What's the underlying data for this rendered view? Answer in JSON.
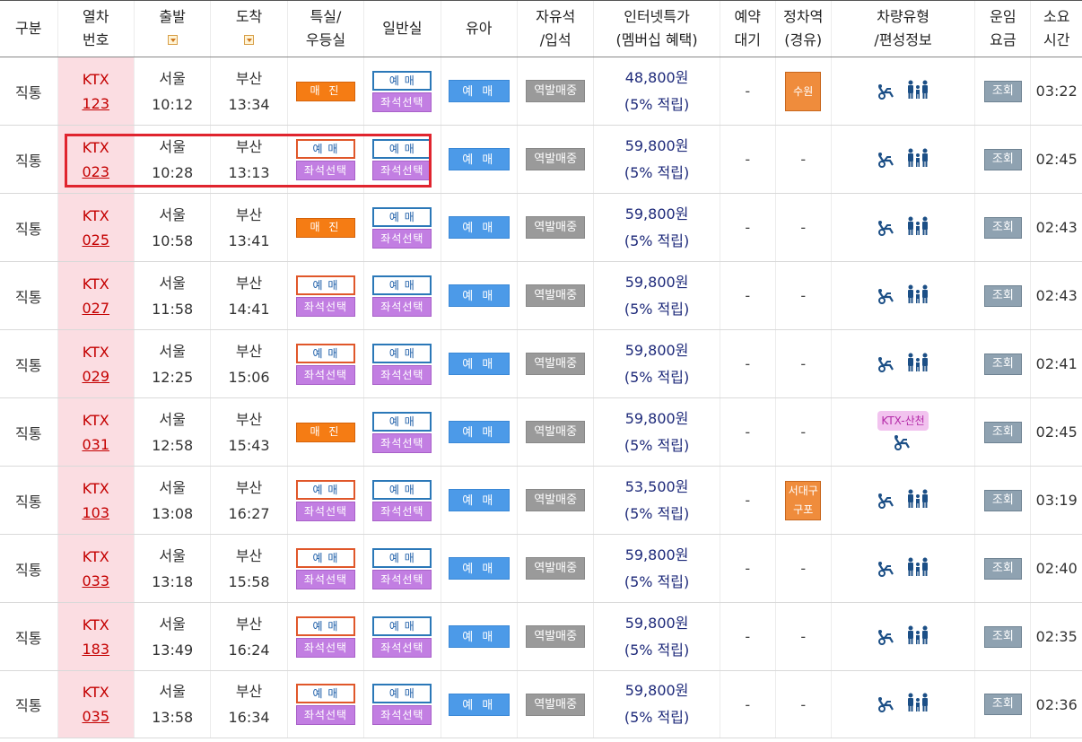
{
  "header": {
    "type": "구분",
    "train_no_1": "열차",
    "train_no_2": "번호",
    "departure": "출발",
    "arrival": "도착",
    "special_1": "특실/",
    "special_2": "우등실",
    "general": "일반실",
    "infant": "유아",
    "free_seat_1": "자유석",
    "free_seat_2": "/입석",
    "web_1": "인터넷특가",
    "web_2": "(멤버십 혜택)",
    "reservation_1": "예약",
    "reservation_2": "대기",
    "stops_1": "정차역",
    "stops_2": "(경유)",
    "car_1": "차량유형",
    "car_2": "/편성정보",
    "fare_1": "운임",
    "fare_2": "요금",
    "duration_1": "소요",
    "duration_2": "시간"
  },
  "labels": {
    "buy": "예 매",
    "seat": "좌석선택",
    "soldout": "매 진",
    "infant": "예 매",
    "station": "역발매중",
    "fare": "조회",
    "dash": "-",
    "ktx_sancheon": "KTX-산천"
  },
  "rows": [
    {
      "type": "직통",
      "train": "KTX",
      "number": "123",
      "dep_st": "서울",
      "dep_time": "10:12",
      "arr_st": "부산",
      "arr_time": "13:34",
      "special": "soldout",
      "price": "48,800원",
      "point": "(5% 적립)",
      "stops": [
        "수원"
      ],
      "car": "standard",
      "duration": "03:22"
    },
    {
      "type": "직통",
      "train": "KTX",
      "number": "023",
      "dep_st": "서울",
      "dep_time": "10:28",
      "arr_st": "부산",
      "arr_time": "13:13",
      "special": "buy",
      "price": "59,800원",
      "point": "(5% 적립)",
      "stops": [],
      "car": "standard",
      "duration": "02:45"
    },
    {
      "type": "직통",
      "train": "KTX",
      "number": "025",
      "dep_st": "서울",
      "dep_time": "10:58",
      "arr_st": "부산",
      "arr_time": "13:41",
      "special": "soldout",
      "price": "59,800원",
      "point": "(5% 적립)",
      "stops": [],
      "car": "standard",
      "duration": "02:43"
    },
    {
      "type": "직통",
      "train": "KTX",
      "number": "027",
      "dep_st": "서울",
      "dep_time": "11:58",
      "arr_st": "부산",
      "arr_time": "14:41",
      "special": "buy",
      "price": "59,800원",
      "point": "(5% 적립)",
      "stops": [],
      "car": "standard",
      "duration": "02:43"
    },
    {
      "type": "직통",
      "train": "KTX",
      "number": "029",
      "dep_st": "서울",
      "dep_time": "12:25",
      "arr_st": "부산",
      "arr_time": "15:06",
      "special": "buy",
      "price": "59,800원",
      "point": "(5% 적립)",
      "stops": [],
      "car": "standard",
      "duration": "02:41"
    },
    {
      "type": "직통",
      "train": "KTX",
      "number": "031",
      "dep_st": "서울",
      "dep_time": "12:58",
      "arr_st": "부산",
      "arr_time": "15:43",
      "special": "soldout",
      "price": "59,800원",
      "point": "(5% 적립)",
      "stops": [],
      "car": "sancheon",
      "duration": "02:45"
    },
    {
      "type": "직통",
      "train": "KTX",
      "number": "103",
      "dep_st": "서울",
      "dep_time": "13:08",
      "arr_st": "부산",
      "arr_time": "16:27",
      "special": "buy",
      "price": "53,500원",
      "point": "(5% 적립)",
      "stops": [
        "서대구",
        "구포"
      ],
      "car": "standard",
      "duration": "03:19"
    },
    {
      "type": "직통",
      "train": "KTX",
      "number": "033",
      "dep_st": "서울",
      "dep_time": "13:18",
      "arr_st": "부산",
      "arr_time": "15:58",
      "special": "buy",
      "price": "59,800원",
      "point": "(5% 적립)",
      "stops": [],
      "car": "standard",
      "duration": "02:40"
    },
    {
      "type": "직통",
      "train": "KTX",
      "number": "183",
      "dep_st": "서울",
      "dep_time": "13:49",
      "arr_st": "부산",
      "arr_time": "16:24",
      "special": "buy",
      "price": "59,800원",
      "point": "(5% 적립)",
      "stops": [],
      "car": "standard",
      "duration": "02:35"
    },
    {
      "type": "직통",
      "train": "KTX",
      "number": "035",
      "dep_st": "서울",
      "dep_time": "13:58",
      "arr_st": "부산",
      "arr_time": "16:34",
      "special": "buy",
      "price": "59,800원",
      "point": "(5% 적립)",
      "stops": [],
      "car": "standard",
      "duration": "02:36"
    }
  ],
  "highlight_row": "023",
  "colors": {
    "train_text": "#c40000",
    "train_bg": "#fbdde2",
    "soldout": "#f57c14",
    "seat_select": "#c27ee2",
    "buy_border": "#2b78b8",
    "infant": "#4c9ae8",
    "price_text": "#1e2a7a",
    "highlight": "#e0242e"
  },
  "icons": {
    "sort": "sort-down-icon",
    "wheelchair": "wheelchair-icon",
    "family": "family-icon"
  }
}
